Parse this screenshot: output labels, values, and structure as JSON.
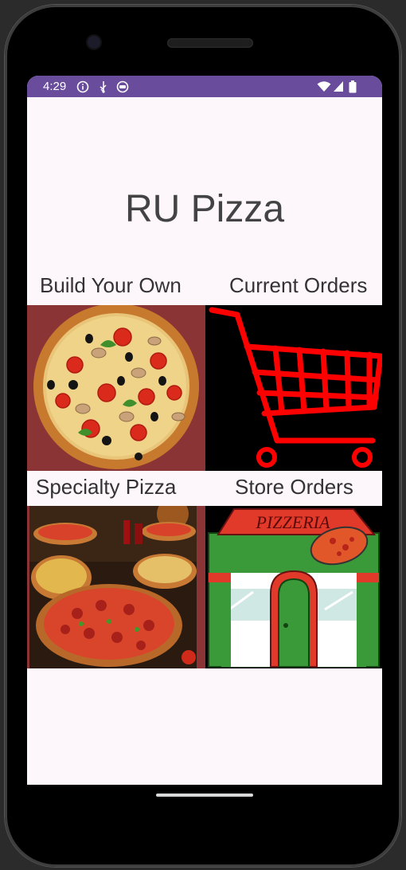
{
  "status_bar": {
    "time": "4:29",
    "left_icons": [
      "info-icon",
      "usb-icon",
      "android-icon"
    ],
    "right_icons": [
      "wifi-icon",
      "signal-icon",
      "battery-icon"
    ],
    "color": "#6a4c9c"
  },
  "app": {
    "title": "RU Pizza",
    "menu": [
      {
        "label": "Build Your Own",
        "image": "pizza-image"
      },
      {
        "label": "Current Orders",
        "image": "shopping-cart-image"
      },
      {
        "label": "Specialty Pizza",
        "image": "specialty-pizzas-image"
      },
      {
        "label": "Store Orders",
        "image": "pizzeria-storefront-image"
      }
    ]
  },
  "pizzeria_sign": "PIZZERIA",
  "colors": {
    "accent": "#6a4c9c",
    "cart_red": "#ff0000",
    "store_green": "#3a9a3a"
  }
}
